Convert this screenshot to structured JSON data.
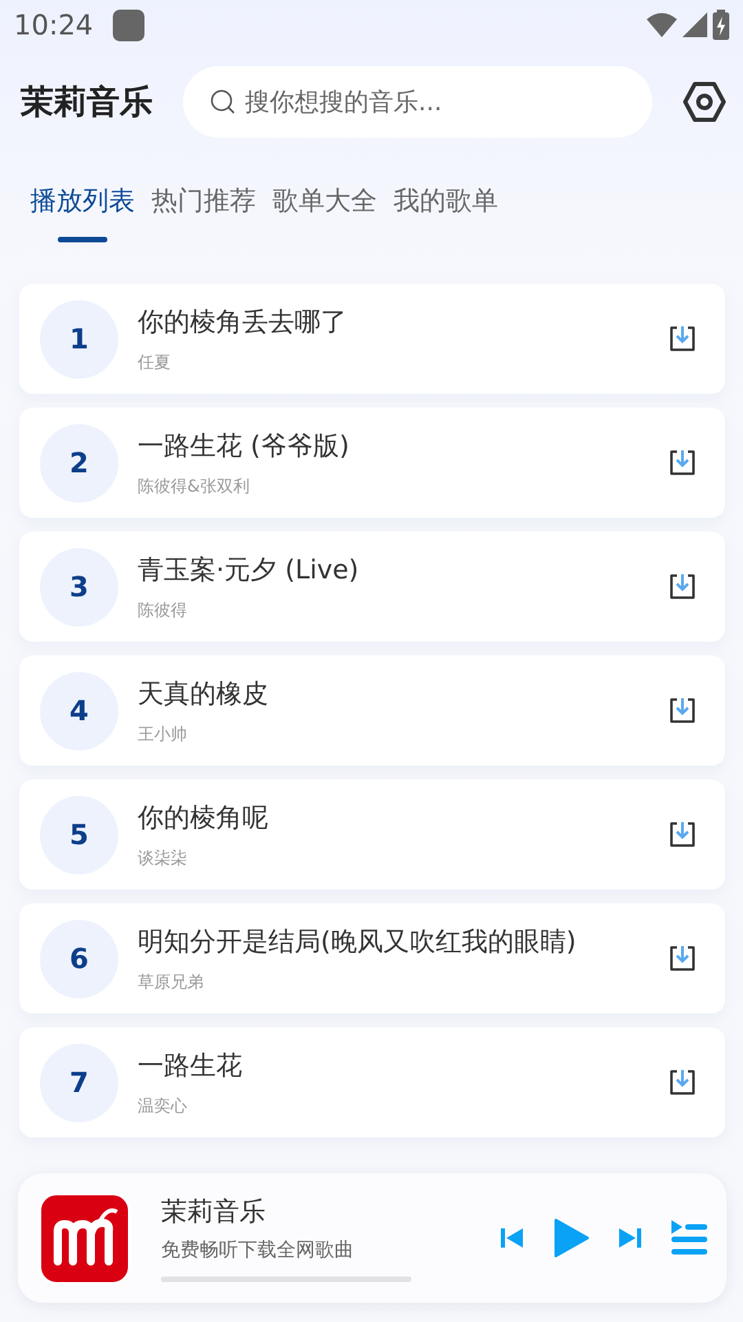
{
  "status_bar": {
    "time": "10:24"
  },
  "header": {
    "title": "茉莉音乐",
    "search": {
      "placeholder": "搜你想搜的音乐..."
    }
  },
  "tabs": [
    {
      "label": "播放列表",
      "selected": true
    },
    {
      "label": "热门推荐",
      "selected": false
    },
    {
      "label": "歌单大全",
      "selected": false
    },
    {
      "label": "我的歌单",
      "selected": false
    }
  ],
  "songs": [
    {
      "number": "1",
      "title": "你的棱角丢去哪了",
      "artist": "任夏"
    },
    {
      "number": "2",
      "title": "一路生花 (爷爷版)",
      "artist": "陈彼得&张双利"
    },
    {
      "number": "3",
      "title": "青玉案·元夕 (Live)",
      "artist": "陈彼得"
    },
    {
      "number": "4",
      "title": "天真的橡皮",
      "artist": "王小帅"
    },
    {
      "number": "5",
      "title": "你的棱角呢",
      "artist": "谈柒柒"
    },
    {
      "number": "6",
      "title": "明知分开是结局(晚风又吹红我的眼睛)",
      "artist": "草原兄弟"
    },
    {
      "number": "7",
      "title": "一路生花",
      "artist": "温奕心"
    }
  ],
  "player": {
    "title": "茉莉音乐",
    "subtitle": "免费畅听下载全网歌曲"
  }
}
